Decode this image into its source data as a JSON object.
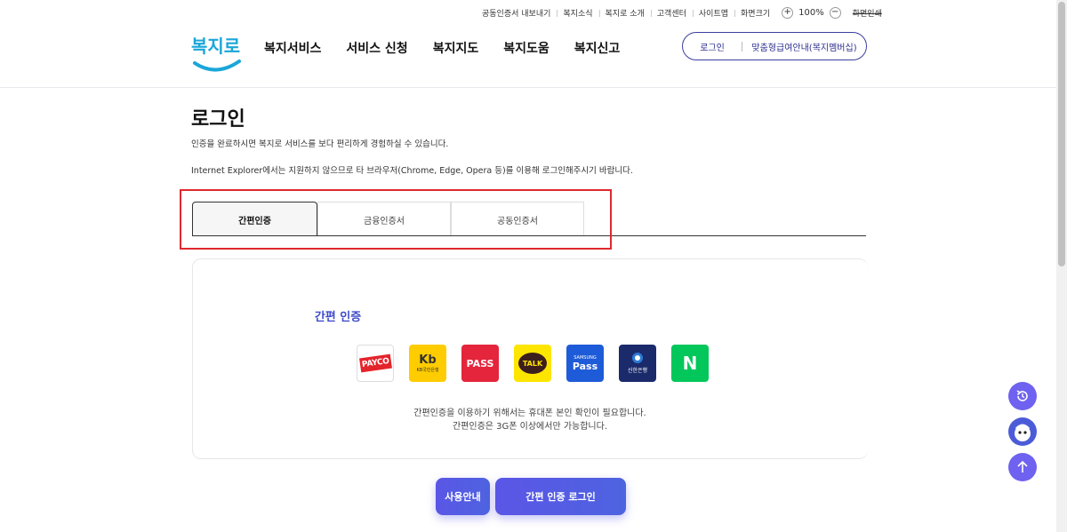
{
  "utility": {
    "items": [
      "공동인증서 내보내기",
      "복지소식",
      "복지로 소개",
      "고객센터",
      "사이트맵"
    ],
    "screen_size_label": "화면크기",
    "zoom_value": "100%",
    "zoom_in": "+",
    "zoom_out": "−",
    "print_label": "화면인쇄"
  },
  "header": {
    "logo_text": "복지로",
    "nav": [
      "복지서비스",
      "서비스 신청",
      "복지지도",
      "복지도움",
      "복지신고"
    ],
    "login_label": "로그인",
    "guide_label": "맞춤형급여안내(복지멤버십)"
  },
  "main": {
    "title": "로그인",
    "desc1": "인증을 완료하시면 복지로 서비스를 보다 편리하게 경험하실 수 있습니다.",
    "desc2": "Internet Explorer에서는 지원하지 않으므로 타 브라우저(Chrome, Edge, Opera 등)를 이용해 로그인해주시기 바랍니다.",
    "tabs": [
      {
        "label": "간편인증",
        "active": true
      },
      {
        "label": "금융인증서",
        "active": false
      },
      {
        "label": "공동인증서",
        "active": false
      }
    ],
    "panel_title": "간편 인증",
    "providers": {
      "payco": "PAYCO",
      "kb_mark": "Kb",
      "kb_text": "KB국민은행",
      "pass": "PASS",
      "talk": "TALK",
      "samsung_top": "SAMSUNG",
      "samsung_main": "Pass",
      "shinhan": "신한은행",
      "naver": "N"
    },
    "note_line1": "간편인증을 이용하기 위해서는 휴대폰 본인 확인이 필요합니다.",
    "note_line2": "간편인증은 3G폰 이상에서만 가능합니다.",
    "guide_button": "사용안내",
    "login_button": "간편 인증 로그인"
  },
  "colors": {
    "accent": "#3f4bc9",
    "button": "#5a56e6",
    "highlight_box": "#e0282e"
  }
}
